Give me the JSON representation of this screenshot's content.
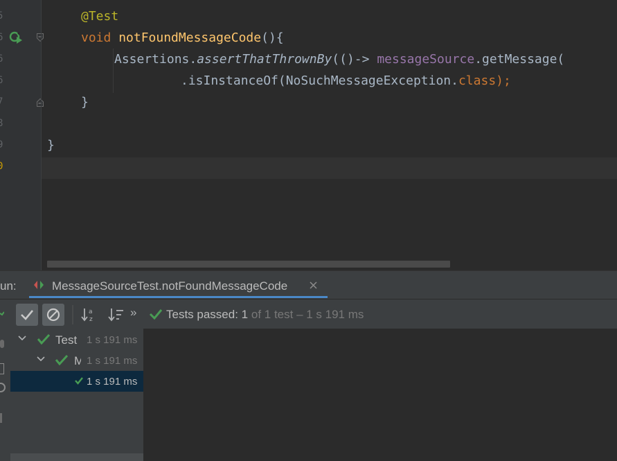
{
  "editor": {
    "line_numbers": [
      "5",
      "6",
      "6",
      "6",
      "7",
      "8",
      "9",
      "0"
    ],
    "lines": {
      "l1_annotation": "@Test",
      "l2_kw": "void",
      "l2_name": "notFoundMessageCode",
      "l2_rest": "(){",
      "l3_prefix": "Assertions.",
      "l3_method": "assertThatThrownBy",
      "l3_mid": "(()-> ",
      "l3_field": "messageSource",
      "l3_tail": ".getMessage(",
      "l4_method": ".isInstanceOf(NoSuchMessageException.",
      "l4_kw": "class",
      "l4_end": ");",
      "l5_close": "}",
      "l7_close": "}"
    }
  },
  "run_panel": {
    "label": "un:",
    "tab_title": "MessageSourceTest.notFoundMessageCode",
    "status_prefix": "Tests passed: ",
    "status_count": "1",
    "status_rest": " of 1 test – 1 s 191 ms",
    "toolbar_more": "»",
    "tree": [
      {
        "label": "Test",
        "time": "1 s 191 ms"
      },
      {
        "label": "M",
        "time": "1 s 191 ms"
      },
      {
        "label": "",
        "time": "1 s 191 ms"
      }
    ]
  },
  "colors": {
    "accent_tab": "#4a88c7",
    "pass_green": "#499c54"
  }
}
